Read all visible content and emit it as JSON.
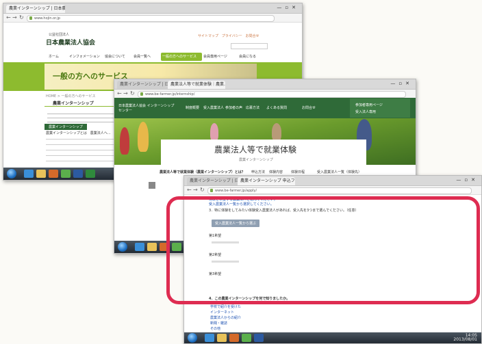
{
  "win1": {
    "tab_title": "農業インターンシップ | 日本農業…",
    "url": "www.hojin.or.jp",
    "org_subtitle": "公益社団法人",
    "org_name": "日本農業法人協会",
    "top_links": [
      "サイトマップ",
      "プライバシー",
      "お問合せ"
    ],
    "nav": [
      "ホーム",
      "インフォメーション",
      "協会について",
      "会員一覧へ",
      "一般の方へのサービス",
      "会員専用ページ",
      "会員になる"
    ],
    "banner": "一般の方へのサービス",
    "breadcrumb": "HOME > 一般の方へのサービス",
    "section_title": "農業インターンシップ",
    "chip": "農業インターンシップ",
    "body_line": "農業インターンシップとは　農業法人へ…"
  },
  "win2": {
    "tab_title": "農業インターンシップ | 日本…",
    "tab2_title": "農業法人等で就業体験｜農業…",
    "url": "www.be-farmer.jp/internship/",
    "logo": "日本農業法人協会 インターンシップセンター",
    "nav": [
      "制度概要",
      "受入農業法人",
      "参加者の声",
      "応募方法",
      "よくある質問",
      "お問合せ"
    ],
    "side_panel": [
      "参加者専用ページ",
      "受入法人専用"
    ],
    "hero_title": "農業法人等で就業体験",
    "hero_sub": "農業インターンシップ",
    "subnav": [
      "農業法人等で就業体験（農業インターンシップ）とは？",
      "申込方法",
      "体験内容",
      "体験日程",
      "受入農業法人一覧（体験先）"
    ]
  },
  "win3": {
    "tab_title": "農業インターンシップ | 日本…",
    "tab2_title": "農業インターンシップ 申込フ…",
    "url": "www.be-farmer.jp/apply/",
    "intro_lines": [
      "体験を希望する農業法人を選んでください。",
      "受入農業法人一覧から選択してください。"
    ],
    "question": "3．特に体験をしてみたい体験受入農業法人があれば、受入先を3つまで選んでください。（任意）",
    "button": "受入農業法人一覧から選ぶ",
    "choices": [
      "第1希望",
      "第2希望",
      "第3希望"
    ],
    "question2": "4．この農業インターンシップを何で知りましたか。",
    "options": [
      "学校で紹介を受けた",
      "インターネット",
      "農業法人からの紹介",
      "新聞・雑誌",
      "その他"
    ]
  },
  "taskbar": {
    "time": "14:05",
    "date": "2013/08/01"
  },
  "colors": {
    "highlight": "#de2c51",
    "green_nav": "#8dbb2f",
    "dark_green": "#2f6a38"
  }
}
